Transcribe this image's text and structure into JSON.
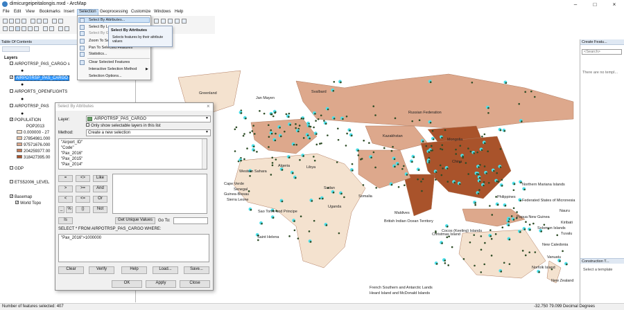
{
  "window": {
    "title": "dimicurgeipeitalongis.mxd - ArcMap"
  },
  "menu": [
    "File",
    "Edit",
    "View",
    "Bookmarks",
    "Insert",
    "Selection",
    "Geoprocessing",
    "Customize",
    "Windows",
    "Help"
  ],
  "selection_menu": {
    "items": [
      "Select By Attributes...",
      "Select By Lo",
      "Select By Gr",
      "Zoom To Se",
      "Pan To Selected Features",
      "Statistics...",
      "Clear Selected Features",
      "Interactive Selection Method",
      "Selection Options..."
    ],
    "tooltip_title": "Select By Attributes",
    "tooltip_text": "Selects features by their attribute values"
  },
  "toc": {
    "header": "Table Of Contents",
    "layers_label": "Layers",
    "layers": [
      "AIRPOTRSP_PAS_CARGO s",
      "AIRPOTRSP_PAS_CARGO",
      "AIRPORTS_OPENFLIGHTS",
      "AIRPOTRSP_PAS",
      "POPULATION",
      "GDP",
      "ETS52006_LEVEL",
      "Basemap"
    ],
    "population_field": "POP2013",
    "population_classes": [
      "0.000000 - 27",
      "27854981.000",
      "97571676.000",
      "204259377.00",
      "318427395.00"
    ],
    "basemap_child": "World Topo"
  },
  "dialog": {
    "title": "Select By Attributes",
    "layer_label": "Layer:",
    "layer_value": "AIRPOTRSP_PAS_CARGO",
    "only_selectable": "Only show selectable layers in this list",
    "method_label": "Method:",
    "method_value": "Create a new selection",
    "fields": [
      "\"Airport_ID\"",
      "\"Code\"",
      "\"Pax_2016\"",
      "\"Pax_2015\"",
      "\"Pax_2014\""
    ],
    "operators": [
      "=",
      "<>",
      "Like",
      ">",
      ">=",
      "And",
      "<",
      "<=",
      "Or",
      "_",
      "%",
      "()",
      "Not"
    ],
    "is_label": "Is",
    "unique_values_button": "Get Unique Values",
    "goto_label": "Go To:",
    "sql_label": "SELECT * FROM AIRPOTRSP_PAS_CARGO WHERE:",
    "sql_value": "\"Pax_2016\">1000000",
    "buttons": [
      "Clear",
      "Verify",
      "Help",
      "Load...",
      "Save..."
    ],
    "bottom_buttons": [
      "OK",
      "Apply",
      "Close"
    ]
  },
  "map_labels": {
    "greenland": "Greenland",
    "jan_mayen": "Jan Mayen",
    "svalbard": "Svalbard",
    "russia": "Russian Federation",
    "kazakhstan": "Kazakhstan",
    "mongolia": "Mongolia",
    "china": "China",
    "algeria": "Algeria",
    "libya": "Libya",
    "sudan": "Sudan",
    "western_sahara": "Western Sahara",
    "cape_verde": "Cape Verde",
    "senegal": "Senegal",
    "guinea_bissau": "Guinea-Bissau",
    "sierra_leone": "Sierra Leone",
    "sao_tome": "Sao Tome and Principe",
    "saint_helena": "Saint Helena",
    "uganda": "Uganda",
    "somalia": "Somalia",
    "maldives": "Maldives",
    "biot": "British Indian Ocean Territory",
    "cocos": "Cocos (Keeling) Islands",
    "christmas": "Christmas Island",
    "northern_mariana": "Northern Mariana Islands",
    "micronesia": "Federated States of Micronesia",
    "nauru": "Nauru",
    "solomon": "Solomon Islands",
    "new_caledonia": "New Caledonia",
    "philippines": "Philippines",
    "kiribati": "Kiribati",
    "tuvalu": "Tuvalu",
    "vanuatu": "Vanuatu",
    "french_southern": "French Southern and Antarctic Lands",
    "heard": "Heard Island and McDonald Islands",
    "new_zealand": "New Zealand",
    "norfolk": "Norfolk Island",
    "papua": "Papua New Guinea"
  },
  "right_panel": {
    "title": "Create Featu...",
    "search": "<Search>",
    "empty_text": "There are no templ...",
    "construction": "Construction T...",
    "select_template": "Select a template"
  },
  "status": {
    "left": "Number of features selected: 407",
    "right": "-32.750  79.099 Decimal Degrees"
  },
  "colors": {
    "cyan": "#4de0ea",
    "point": "#2f4d27",
    "land_light": "#f4e2cf",
    "land_mid": "#dda88c",
    "land_dark": "#a9532b",
    "highlight": "#3399ff"
  }
}
